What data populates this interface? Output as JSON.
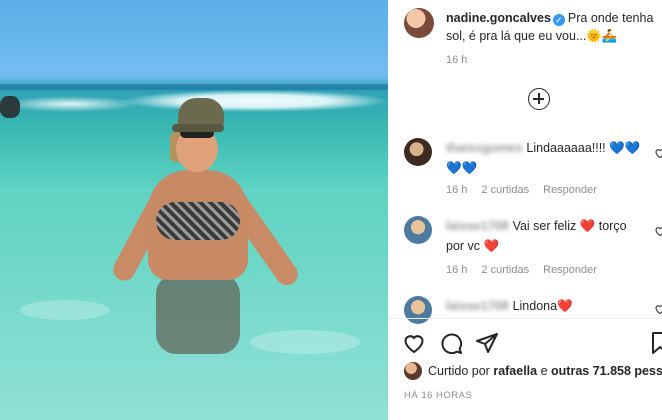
{
  "post": {
    "username": "nadine.goncalves",
    "caption": "Pra onde tenha sol, é pra lá que eu vou...🌞🚣",
    "time": "16 h",
    "icons": {
      "verified": "verified-badge-icon",
      "load_more": "plus-circle-icon"
    }
  },
  "comments": [
    {
      "user": "thaissgomes",
      "text": "Lindaaaaaa!!!! 💙💙💙💙",
      "time": "16 h",
      "likes": "",
      "reply": "Responder"
    },
    {
      "user": "laisse1708",
      "text": "Vai ser feliz ❤️ torço por vc ❤️",
      "time": "16 h",
      "likes": "2 curtidas",
      "reply": "Responder"
    },
    {
      "user": "laisse1708",
      "text": "Lindona❤️",
      "time": "",
      "likes": "",
      "reply": ""
    }
  ],
  "comment_meta_extra": {
    "first_likes": "2 curtidas"
  },
  "actions": {
    "like": "heart-icon",
    "comment": "comment-icon",
    "share": "send-icon",
    "save": "bookmark-icon"
  },
  "likes_line": {
    "prefix": "Curtido por",
    "user": "rafaella",
    "middle": "e",
    "others": "outras 71.858 pesso"
  },
  "time_ago": "HÁ 16 HORAS"
}
